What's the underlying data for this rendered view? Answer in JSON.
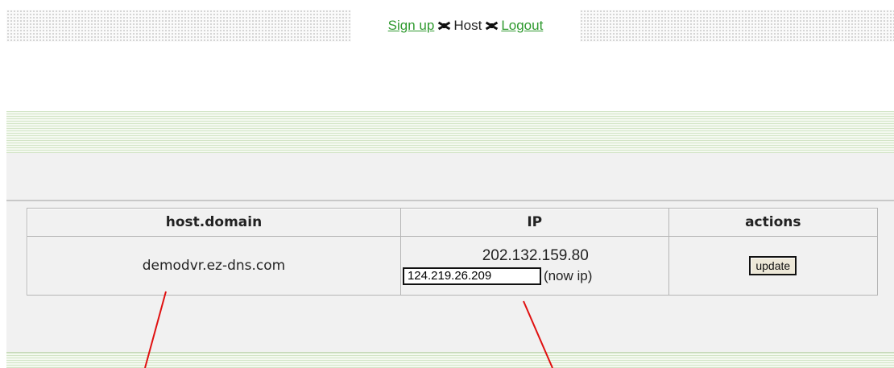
{
  "nav": {
    "signup_label": "Sign up ",
    "host_label": "Host",
    "logout_label": "Logout"
  },
  "table": {
    "headers": [
      "host.domain",
      "IP",
      "actions"
    ],
    "rows": [
      {
        "host": "demodvr.ez-dns.com",
        "current_ip": "202.132.159.80",
        "new_ip_value": "124.219.26.209",
        "ip_note": "(now ip)",
        "action_label": "update"
      }
    ]
  },
  "colors": {
    "link": "#2f9a2f",
    "annotation": "#e01010",
    "panel": "#f1f1f1"
  }
}
